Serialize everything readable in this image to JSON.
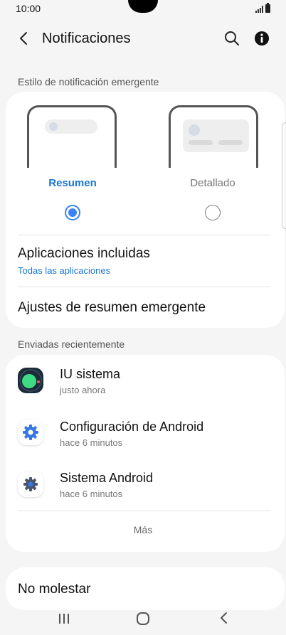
{
  "status_bar": {
    "time": "10:00"
  },
  "header": {
    "title": "Notificaciones"
  },
  "popup_style": {
    "section_label": "Estilo de notificación emergente",
    "options": [
      {
        "label": "Resumen",
        "selected": true
      },
      {
        "label": "Detallado",
        "selected": false
      }
    ],
    "included_apps": {
      "title": "Aplicaciones incluidas",
      "value": "Todas las aplicaciones"
    },
    "brief_settings": {
      "title": "Ajustes de resumen emergente"
    }
  },
  "recent": {
    "section_label": "Enviadas recientemente",
    "apps": [
      {
        "name": "IU sistema",
        "time": "justo ahora",
        "icon": "system-ui-icon"
      },
      {
        "name": "Configuración de Android",
        "time": "hace 6 minutos",
        "icon": "settings-gear-icon"
      },
      {
        "name": "Sistema Android",
        "time": "hace 6 minutos",
        "icon": "android-system-icon"
      }
    ],
    "more_label": "Más"
  },
  "do_not_disturb": {
    "title": "No molestar"
  },
  "colors": {
    "accent": "#1976d2",
    "radio": "#3b82f6",
    "background": "#f5f5f5"
  }
}
